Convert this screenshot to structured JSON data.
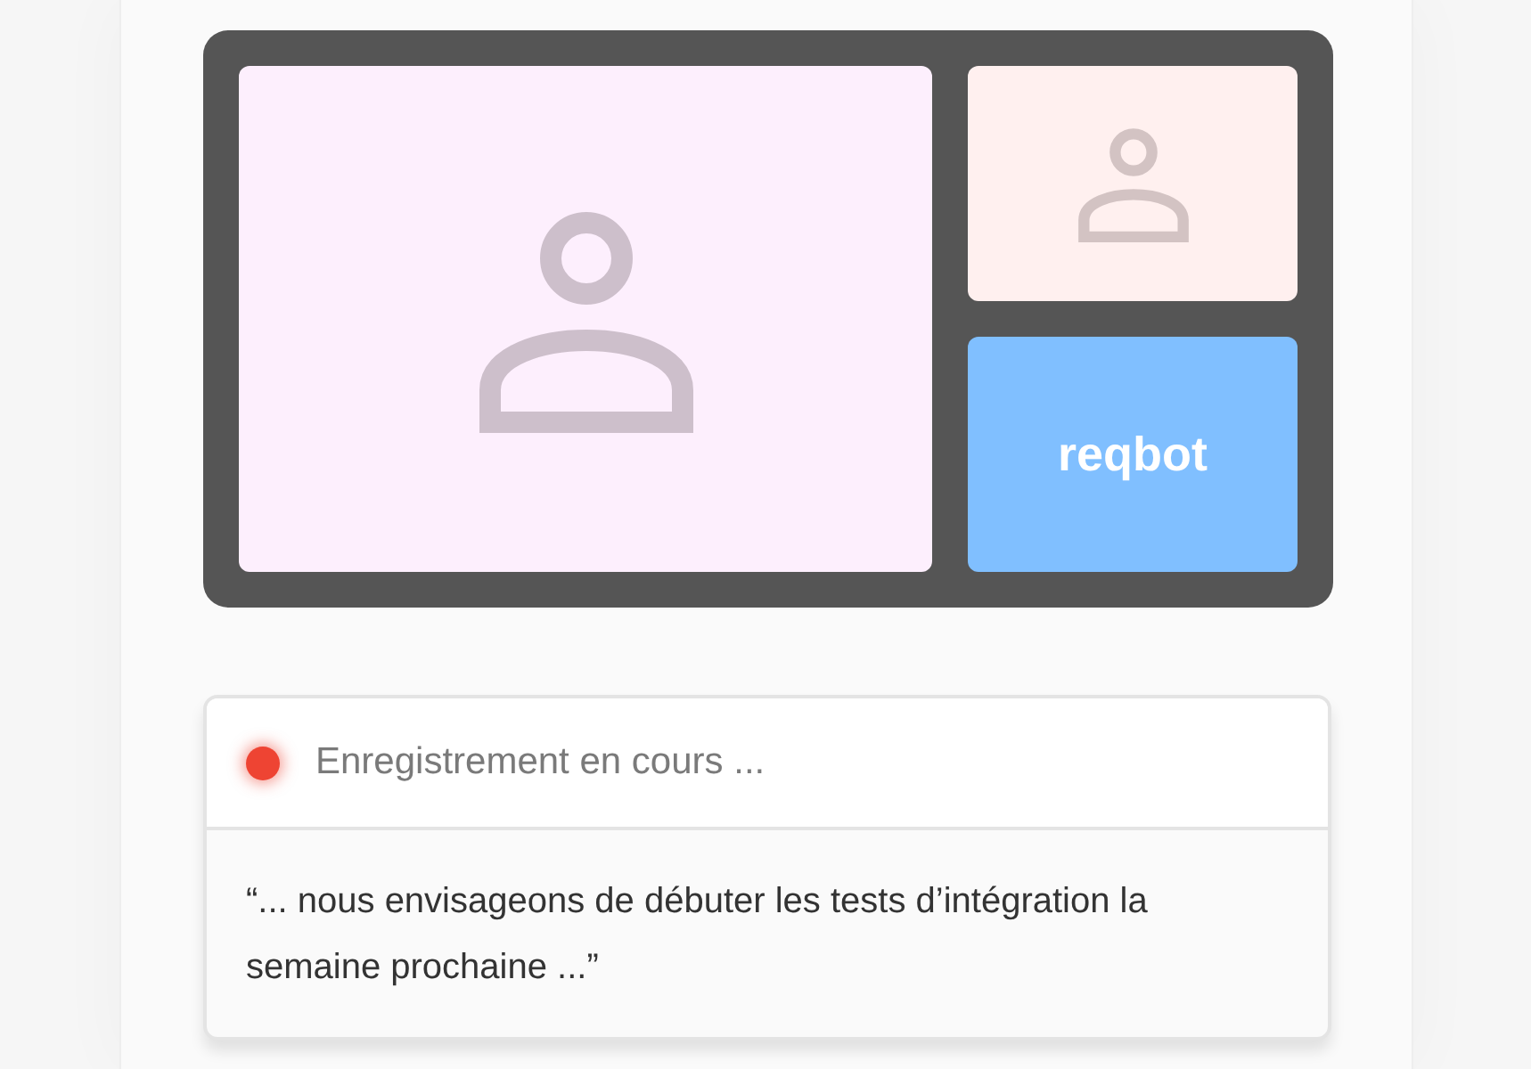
{
  "video_call": {
    "tiles": [
      {
        "kind": "person",
        "color": "#fdeffd"
      },
      {
        "kind": "person",
        "color": "#fff0ef"
      },
      {
        "kind": "bot",
        "color": "#80bfff",
        "label": "reqbot"
      }
    ]
  },
  "recording": {
    "recording": true,
    "status": "Enregistrement en cours ...",
    "transcript": "“... nous envisageons de débuter les tests d’intégration la semaine prochaine ...”"
  }
}
